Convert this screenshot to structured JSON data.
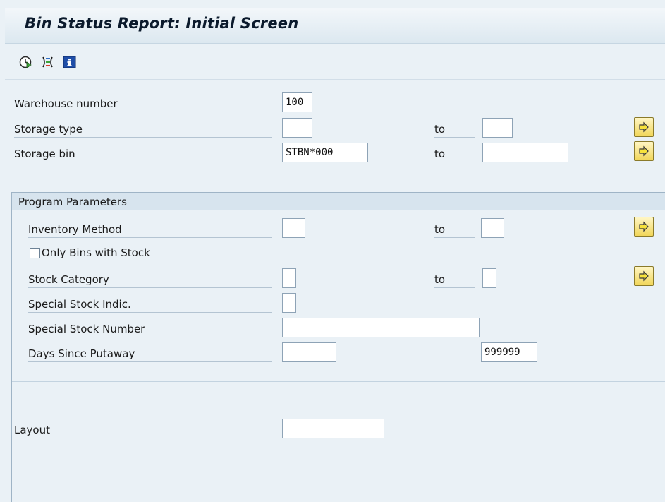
{
  "title": "Bin Status Report: Initial Screen",
  "toolbar": {
    "icons": [
      "execute-icon",
      "selection-options-icon",
      "program-doc-info-icon"
    ]
  },
  "fields": {
    "warehouse_number": {
      "label": "Warehouse number",
      "value": "100"
    },
    "storage_type": {
      "label": "Storage type",
      "to": "to",
      "from_value": "",
      "to_value": ""
    },
    "storage_bin": {
      "label": "Storage bin",
      "to": "to",
      "from_value": "STBN*000",
      "to_value": ""
    }
  },
  "program_parameters": {
    "title": "Program Parameters",
    "inventory_method": {
      "label": "Inventory Method",
      "to": "to",
      "from_value": "",
      "to_value": ""
    },
    "only_bins_with_stock": {
      "label": "Only Bins with Stock",
      "checked": false
    },
    "stock_category": {
      "label": "Stock Category",
      "to": "to",
      "from_value": "",
      "to_value": ""
    },
    "special_stock_indic": {
      "label": "Special Stock Indic.",
      "value": ""
    },
    "special_stock_number": {
      "label": "Special Stock Number",
      "value": ""
    },
    "days_since_putaway": {
      "label": "Days Since Putaway",
      "from_value": "",
      "to_value": "999999"
    }
  },
  "layout": {
    "label": "Layout",
    "value": ""
  },
  "colors": {
    "multi_button": "#f1d65a",
    "title_bg": "#dce8f0",
    "page_bg": "#eaf1f6"
  }
}
